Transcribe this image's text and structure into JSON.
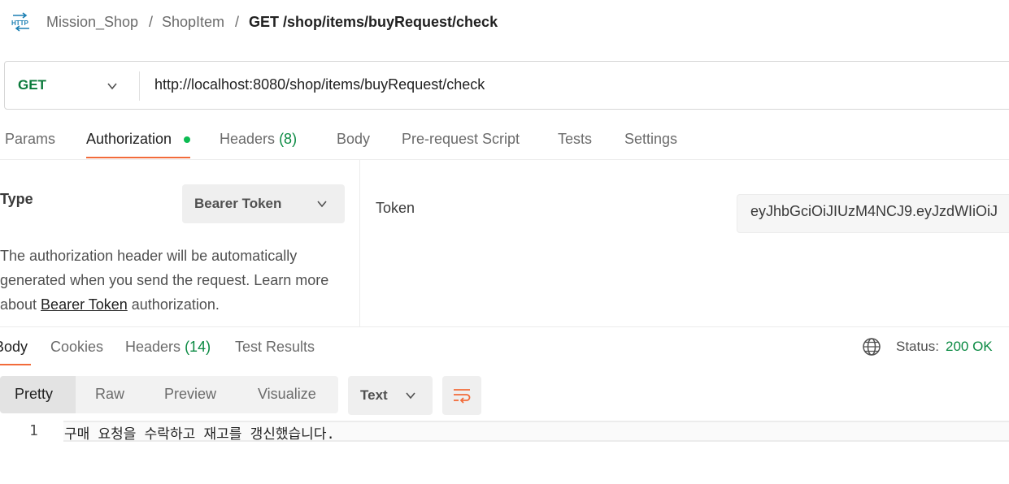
{
  "breadcrumb": {
    "icon": "http-icon",
    "collection": "Mission_Shop",
    "folder": "ShopItem",
    "separator": "/",
    "request": "GET /shop/items/buyRequest/check"
  },
  "request": {
    "method": "GET",
    "url": "http://localhost:8080/shop/items/buyRequest/check"
  },
  "request_tabs": [
    {
      "label": "Params",
      "count": ""
    },
    {
      "label": "Authorization",
      "count": "",
      "active": true
    },
    {
      "label": "Headers",
      "count": "(8)"
    },
    {
      "label": "Body",
      "count": ""
    },
    {
      "label": "Pre-request Script",
      "count": ""
    },
    {
      "label": "Tests",
      "count": ""
    },
    {
      "label": "Settings",
      "count": ""
    }
  ],
  "auth": {
    "type_label": "Type",
    "type_value": "Bearer Token",
    "description_pre": "The authorization header will be automatically generated when you send the request. Learn more about ",
    "description_link": "Bearer Token",
    "description_post": " authorization.",
    "token_label": "Token",
    "token_value": "eyJhbGciOiJIUzM4NCJ9.eyJzdWIiOiJ"
  },
  "response_tabs": [
    {
      "label": "Body",
      "count": "",
      "active": true
    },
    {
      "label": "Cookies",
      "count": ""
    },
    {
      "label": "Headers",
      "count": "(14)"
    },
    {
      "label": "Test Results",
      "count": ""
    }
  ],
  "status": {
    "label": "Status:",
    "value": "200 OK"
  },
  "view_modes": [
    "Pretty",
    "Raw",
    "Preview",
    "Visualize"
  ],
  "format": "Text",
  "body": {
    "line_number": "1",
    "text": "구매 요청을 수락하고 재고를 갱신했습니다."
  },
  "colors": {
    "accent": "#f26b3a",
    "method_get": "#0b7a3b",
    "success": "#0b8a43"
  }
}
